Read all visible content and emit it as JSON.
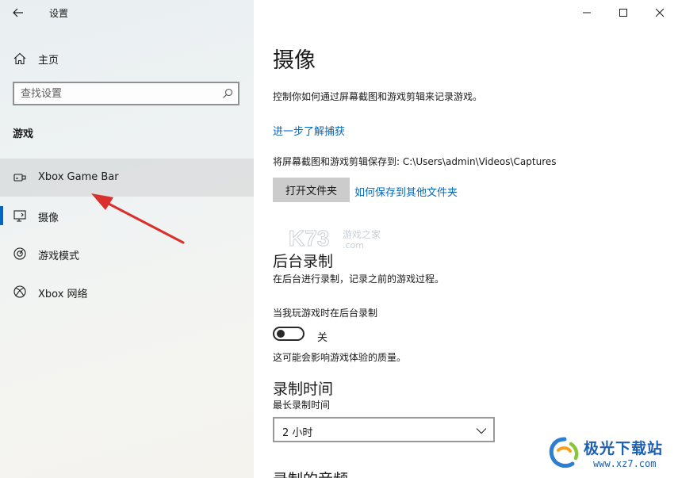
{
  "window": {
    "title": "设置"
  },
  "sidebar": {
    "home_label": "主页",
    "search_placeholder": "查找设置",
    "section_title": "游戏",
    "items": [
      {
        "label": "Xbox Game Bar",
        "icon": "game-bar-icon",
        "hover": true,
        "selected": false
      },
      {
        "label": "摄像",
        "icon": "capture-icon",
        "hover": false,
        "selected": true
      },
      {
        "label": "游戏模式",
        "icon": "game-mode-icon",
        "hover": false,
        "selected": false
      },
      {
        "label": "Xbox 网络",
        "icon": "xbox-icon",
        "hover": false,
        "selected": false
      }
    ]
  },
  "main": {
    "title": "摄像",
    "description": "控制你如何通过屏幕截图和游戏剪辑来记录游戏。",
    "learn_more": "进一步了解捕获",
    "save_path": "将屏幕截图和游戏剪辑保存到: C:\\Users\\admin\\Videos\\Captures",
    "open_folder_button": "打开文件夹",
    "save_elsewhere_link": "如何保存到其他文件夹",
    "background_recording": {
      "title": "后台录制",
      "description": "在后台进行录制，记录之前的游戏过程。",
      "toggle_label": "当我玩游戏时在后台录制",
      "toggle_state": "关",
      "toggle_on": false,
      "note": "这可能会影响游戏体验的质量。"
    },
    "record_time": {
      "title": "录制时间",
      "max_label": "最长录制时间",
      "selected": "2 小时"
    },
    "next_section_title": "录制的音频"
  },
  "watermark": {
    "text": "K73",
    "sub": "游戏之家",
    "domain": ".com"
  },
  "brand": {
    "name": "极光下载站",
    "url": "www.xz7.com"
  },
  "colors": {
    "accent": "#0067c0",
    "annotation_arrow": "#d9302c",
    "brand": "#1d5fb0"
  }
}
